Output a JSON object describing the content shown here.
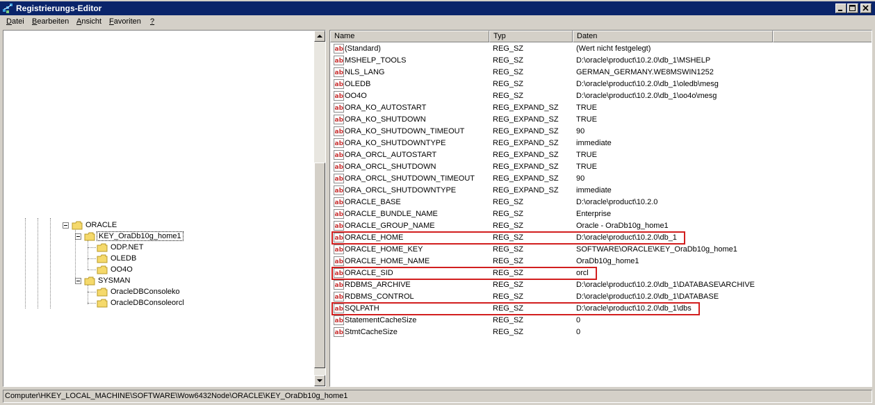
{
  "window": {
    "title": "Registrierungs-Editor"
  },
  "menu": [
    {
      "label": "Datei",
      "mnemonic": "D"
    },
    {
      "label": "Bearbeiten",
      "mnemonic": "B"
    },
    {
      "label": "Ansicht",
      "mnemonic": "A"
    },
    {
      "label": "Favoriten",
      "mnemonic": "F"
    },
    {
      "label": "?",
      "mnemonic": "?"
    }
  ],
  "tree": [
    {
      "label": "ORACLE",
      "expanded": true
    },
    {
      "label": "KEY_OraDb10g_home1",
      "expanded": true,
      "selected": true
    },
    {
      "label": "ODP.NET"
    },
    {
      "label": "OLEDB"
    },
    {
      "label": "OO4O"
    },
    {
      "label": "SYSMAN",
      "expanded": true
    },
    {
      "label": "OracleDBConsoleko"
    },
    {
      "label": "OracleDBConsoleorcl"
    }
  ],
  "columns": {
    "name": "Name",
    "type": "Typ",
    "data": "Daten"
  },
  "values": [
    {
      "name": "(Standard)",
      "type": "REG_SZ",
      "data": "(Wert nicht festgelegt)"
    },
    {
      "name": "MSHELP_TOOLS",
      "type": "REG_SZ",
      "data": "D:\\oracle\\product\\10.2.0\\db_1\\MSHELP"
    },
    {
      "name": "NLS_LANG",
      "type": "REG_SZ",
      "data": "GERMAN_GERMANY.WE8MSWIN1252"
    },
    {
      "name": "OLEDB",
      "type": "REG_SZ",
      "data": "D:\\oracle\\product\\10.2.0\\db_1\\oledb\\mesg"
    },
    {
      "name": "OO4O",
      "type": "REG_SZ",
      "data": "D:\\oracle\\product\\10.2.0\\db_1\\oo4o\\mesg"
    },
    {
      "name": "ORA_KO_AUTOSTART",
      "type": "REG_EXPAND_SZ",
      "data": "TRUE"
    },
    {
      "name": "ORA_KO_SHUTDOWN",
      "type": "REG_EXPAND_SZ",
      "data": "TRUE"
    },
    {
      "name": "ORA_KO_SHUTDOWN_TIMEOUT",
      "type": "REG_EXPAND_SZ",
      "data": "90"
    },
    {
      "name": "ORA_KO_SHUTDOWNTYPE",
      "type": "REG_EXPAND_SZ",
      "data": "immediate"
    },
    {
      "name": "ORA_ORCL_AUTOSTART",
      "type": "REG_EXPAND_SZ",
      "data": "TRUE"
    },
    {
      "name": "ORA_ORCL_SHUTDOWN",
      "type": "REG_EXPAND_SZ",
      "data": "TRUE"
    },
    {
      "name": "ORA_ORCL_SHUTDOWN_TIMEOUT",
      "type": "REG_EXPAND_SZ",
      "data": "90"
    },
    {
      "name": "ORA_ORCL_SHUTDOWNTYPE",
      "type": "REG_EXPAND_SZ",
      "data": "immediate"
    },
    {
      "name": "ORACLE_BASE",
      "type": "REG_SZ",
      "data": "D:\\oracle\\product\\10.2.0"
    },
    {
      "name": "ORACLE_BUNDLE_NAME",
      "type": "REG_SZ",
      "data": "Enterprise"
    },
    {
      "name": "ORACLE_GROUP_NAME",
      "type": "REG_SZ",
      "data": "Oracle - OraDb10g_home1"
    },
    {
      "name": "ORACLE_HOME",
      "type": "REG_SZ",
      "data": "D:\\oracle\\product\\10.2.0\\db_1",
      "highlighted": true
    },
    {
      "name": "ORACLE_HOME_KEY",
      "type": "REG_SZ",
      "data": "SOFTWARE\\ORACLE\\KEY_OraDb10g_home1"
    },
    {
      "name": "ORACLE_HOME_NAME",
      "type": "REG_SZ",
      "data": "OraDb10g_home1"
    },
    {
      "name": "ORACLE_SID",
      "type": "REG_SZ",
      "data": "orcl",
      "highlighted": true
    },
    {
      "name": "RDBMS_ARCHIVE",
      "type": "REG_SZ",
      "data": "D:\\oracle\\product\\10.2.0\\db_1\\DATABASE\\ARCHIVE"
    },
    {
      "name": "RDBMS_CONTROL",
      "type": "REG_SZ",
      "data": "D:\\oracle\\product\\10.2.0\\db_1\\DATABASE"
    },
    {
      "name": "SQLPATH",
      "type": "REG_SZ",
      "data": "D:\\oracle\\product\\10.2.0\\db_1\\dbs",
      "highlighted": true
    },
    {
      "name": "StatementCacheSize",
      "type": "REG_SZ",
      "data": "0"
    },
    {
      "name": "StmtCacheSize",
      "type": "REG_SZ",
      "data": "0"
    }
  ],
  "status": {
    "path": "Computer\\HKEY_LOCAL_MACHINE\\SOFTWARE\\Wow6432Node\\ORACLE\\KEY_OraDb10g_home1"
  },
  "colors": {
    "titlebar": "#0a246a",
    "highlight_box": "#d21e1e",
    "folder": "#f5d96b"
  },
  "icons": {
    "value": "reg-string-icon",
    "folder": "folder-icon",
    "app": "regedit-icon"
  }
}
